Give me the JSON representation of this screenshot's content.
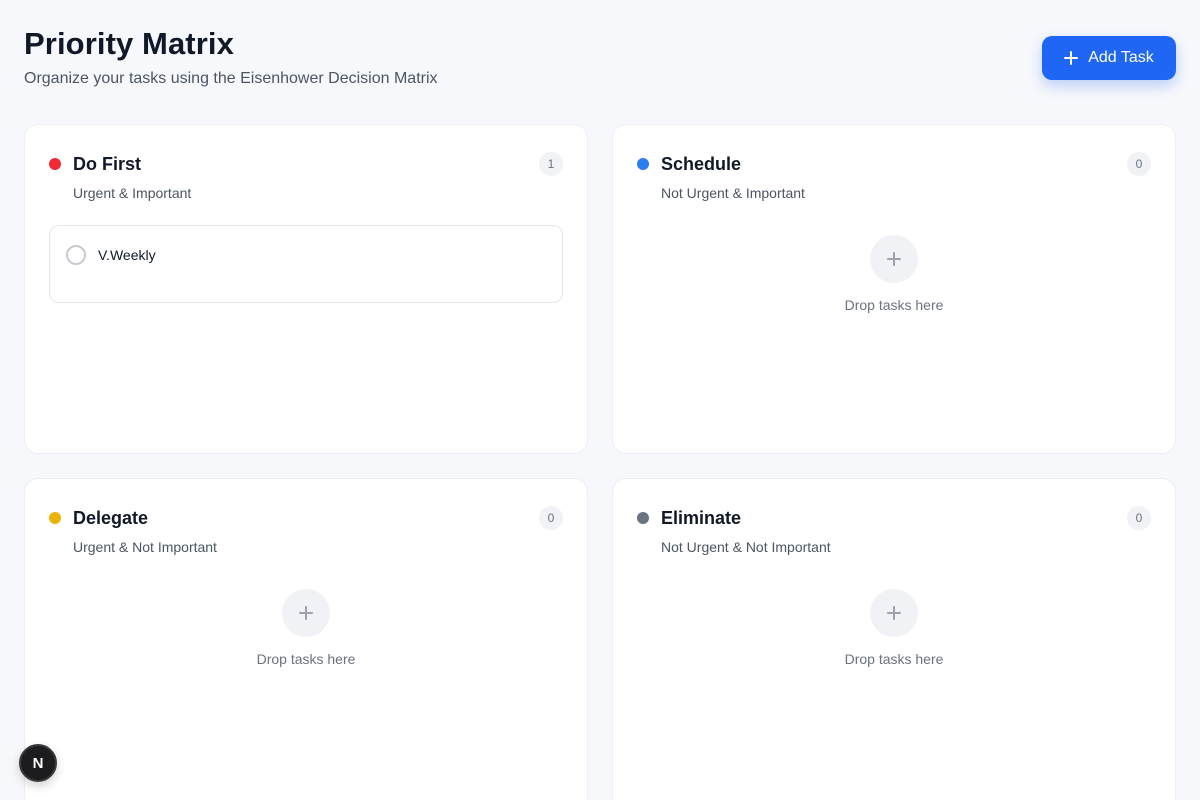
{
  "header": {
    "title": "Priority Matrix",
    "subtitle": "Organize your tasks using the Eisenhower Decision Matrix",
    "add_button_label": "Add Task",
    "add_button_icon": "plus-icon"
  },
  "colors": {
    "accent": "#1f66f5",
    "do_first": "#ef2b36",
    "schedule": "#2b7cf0",
    "delegate": "#eab308",
    "eliminate": "#6b7280"
  },
  "quadrants": [
    {
      "title": "Do First",
      "subtitle": "Urgent & Important",
      "count": "1",
      "dot_color": "#ef2b36",
      "tasks": [
        {
          "title": "V.Weekly",
          "done": false
        }
      ]
    },
    {
      "title": "Schedule",
      "subtitle": "Not Urgent & Important",
      "count": "0",
      "dot_color": "#2b7cf0",
      "empty_label": "Drop tasks here"
    },
    {
      "title": "Delegate",
      "subtitle": "Urgent & Not Important",
      "count": "0",
      "dot_color": "#eab308",
      "empty_label": "Drop tasks here"
    },
    {
      "title": "Eliminate",
      "subtitle": "Not Urgent & Not Important",
      "count": "0",
      "dot_color": "#6b7280",
      "empty_label": "Drop tasks here"
    }
  ],
  "dev_badge": {
    "label": "N"
  }
}
